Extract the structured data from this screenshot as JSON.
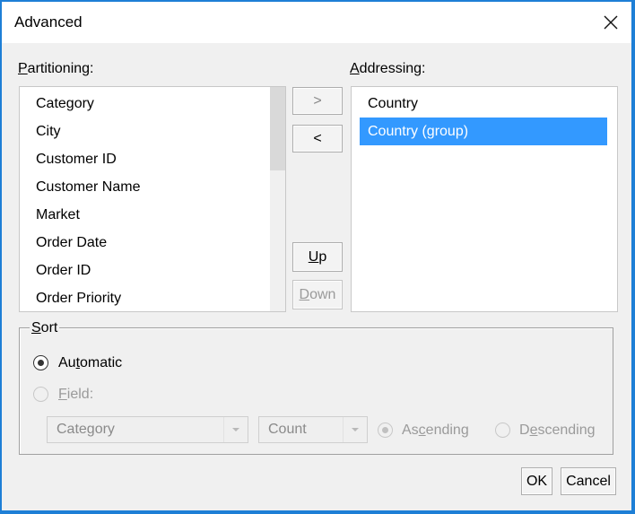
{
  "window": {
    "title": "Advanced",
    "close_icon": "close-x-icon"
  },
  "partitioning": {
    "label_u": "P",
    "label_rest": "artitioning:",
    "items": [
      "Category",
      "City",
      "Customer ID",
      "Customer Name",
      "Market",
      "Order Date",
      "Order ID",
      "Order Priority"
    ]
  },
  "addressing": {
    "label_u": "A",
    "label_rest": "ddressing:",
    "items": [
      "Country",
      "Country (group)"
    ],
    "selected_index": 1
  },
  "move_buttons": {
    "right": ">",
    "left": "<",
    "up_u": "U",
    "up_rest": "p",
    "down_u": "D",
    "down_rest": "own"
  },
  "sort": {
    "legend_u": "S",
    "legend_rest": "ort",
    "automatic_pre": "Au",
    "automatic_u": "t",
    "automatic_post": "omatic",
    "automatic_checked": true,
    "field_u": "F",
    "field_rest": "ield:",
    "field_checked": false,
    "field_combo_value": "Category",
    "aggregation_combo_value": "Count",
    "ascending_pre": "As",
    "ascending_u": "c",
    "ascending_post": "ending",
    "ascending_checked": true,
    "descending_pre": "D",
    "descending_u": "e",
    "descending_post": "scending",
    "descending_checked": false
  },
  "footer": {
    "ok": "OK",
    "cancel": "Cancel"
  },
  "colors": {
    "window_border": "#1e7fd6",
    "selection": "#3399ff",
    "dialog_bg": "#f0f0f0"
  }
}
